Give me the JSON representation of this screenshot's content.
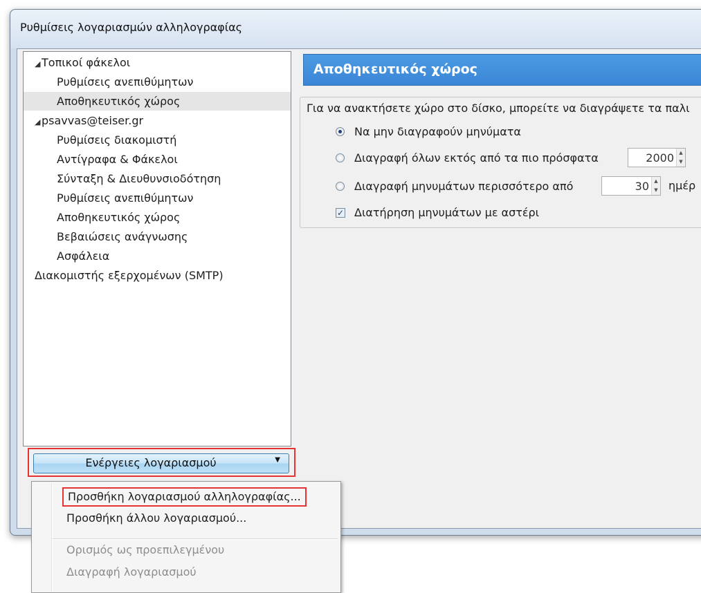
{
  "window": {
    "title": "Ρυθμίσεις λογαριασμών αλληλογραφίας"
  },
  "tree": {
    "items": [
      {
        "label": "Τοπικοί φάκελοι",
        "level": 0,
        "expanded": true
      },
      {
        "label": "Ρυθμίσεις ανεπιθύμητων",
        "level": 1
      },
      {
        "label": "Αποθηκευτικός χώρος",
        "level": 1,
        "selected": true
      },
      {
        "label": "psavvas@teiser.gr",
        "level": 0,
        "expanded": true
      },
      {
        "label": "Ρυθμίσεις διακομιστή",
        "level": 1
      },
      {
        "label": "Αντίγραφα & Φάκελοι",
        "level": 1
      },
      {
        "label": "Σύνταξη & Διευθυνσιοδότηση",
        "level": 1
      },
      {
        "label": "Ρυθμίσεις ανεπιθύμητων",
        "level": 1
      },
      {
        "label": "Αποθηκευτικός χώρος",
        "level": 1
      },
      {
        "label": "Βεβαιώσεις ανάγνωσης",
        "level": 1
      },
      {
        "label": "Ασφάλεια",
        "level": 1
      },
      {
        "label": "Διακομιστής εξερχομένων (SMTP)",
        "level": 0
      }
    ]
  },
  "actions": {
    "label": "Ενέργειες λογαριασμού"
  },
  "menu": {
    "items": [
      {
        "label": "Προσθήκη λογαριασμού αλληλογραφίας...",
        "enabled": true,
        "highlighted": true
      },
      {
        "label": "Προσθήκη άλλου λογαριασμού...",
        "enabled": true
      },
      {
        "label": "Ορισμός ως προεπιλεγμένου",
        "enabled": false
      },
      {
        "label": "Διαγραφή λογαριασμού",
        "enabled": false
      }
    ]
  },
  "panel": {
    "header": "Αποθηκευτικός χώρος",
    "intro": "Για να ανακτήσετε χώρο στο δίσκο, μπορείτε να διαγράψετε τα παλι",
    "options": [
      {
        "label": "Να μην διαγραφούν μηνύματα",
        "checked": true
      },
      {
        "label": "Διαγραφή όλων εκτός από τα πιο πρόσφατα",
        "checked": false,
        "value": "2000"
      },
      {
        "label": "Διαγραφή μηνυμάτων περισσότερο από",
        "checked": false,
        "value": "30",
        "suffix": "ημέρ"
      }
    ],
    "keep_starred": {
      "label": "Διατήρηση μηνυμάτων με αστέρι",
      "checked": true
    }
  },
  "colors": {
    "header_blue": "#3a86d6",
    "highlight_red": "#e53333"
  }
}
